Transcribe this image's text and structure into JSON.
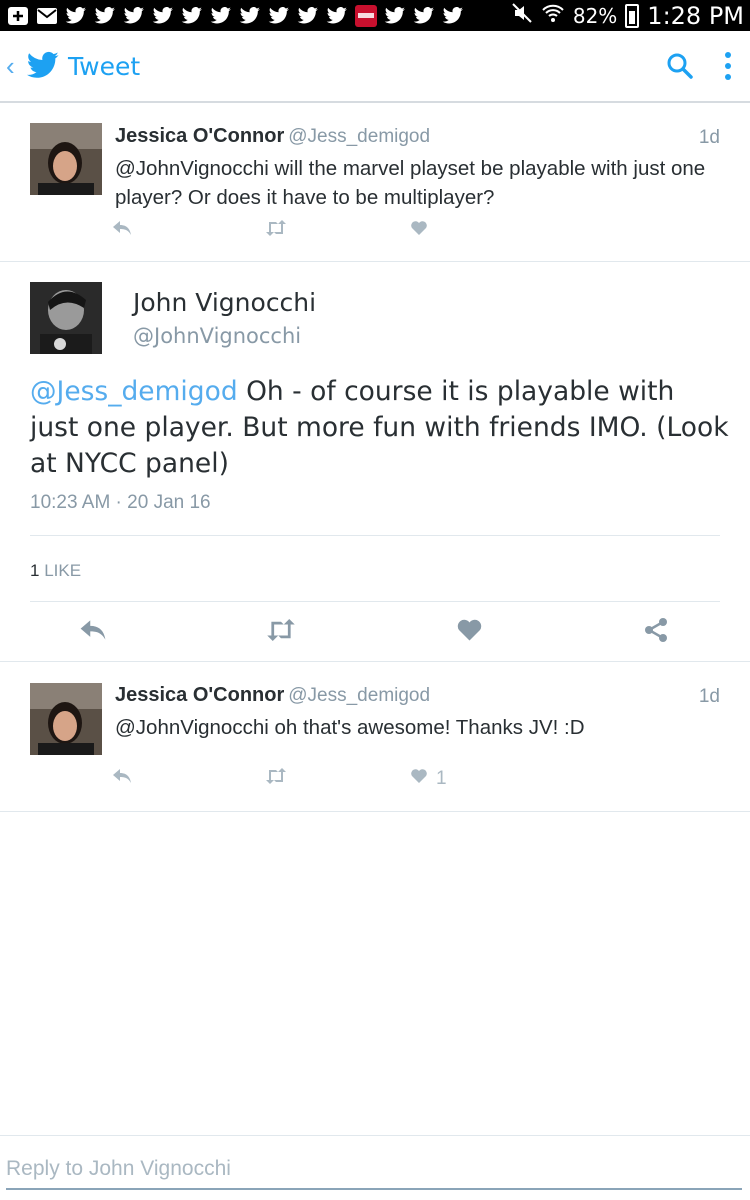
{
  "status_bar": {
    "battery_percent": "82%",
    "time": "1:28 PM",
    "notification_icons": [
      "plus-box-icon",
      "mail-icon",
      "twitter-icon",
      "twitter-icon",
      "twitter-icon",
      "twitter-icon",
      "twitter-icon",
      "twitter-icon",
      "twitter-icon",
      "twitter-icon",
      "twitter-icon",
      "redbox-icon",
      "twitter-icon",
      "twitter-icon",
      "twitter-icon"
    ]
  },
  "app_bar": {
    "back_icon": "chevron-left-icon",
    "title": "Tweet",
    "search_icon": "search-icon",
    "menu_icon": "more-vert-icon"
  },
  "colors": {
    "brand": "#1da1f2",
    "mention": "#55acee",
    "muted": "#8899a6",
    "action_gray": "#aab8c2",
    "text": "#292f33"
  },
  "parent_tweet": {
    "name": "Jessica O'Connor",
    "handle": "@Jess_demigod",
    "time": "1d",
    "text": "@JohnVignocchi will the marvel playset be playable with just one player? Or does it have to be multiplayer?"
  },
  "main_tweet": {
    "name": "John Vignocchi",
    "handle": "@JohnVignocchi",
    "mention": "@Jess_demigod",
    "text": " Oh - of course it is playable with just one player. But more fun with friends IMO. (Look at NYCC panel)",
    "timestamp": "10:23 AM · 20 Jan 16",
    "like_count": "1",
    "like_label": "LIKE"
  },
  "reply_tweet": {
    "name": "Jessica O'Connor",
    "handle": "@Jess_demigod",
    "time": "1d",
    "text": "@JohnVignocchi oh that's awesome! Thanks JV! :D",
    "like_count": "1"
  },
  "composer": {
    "placeholder": "Reply to John Vignocchi"
  }
}
